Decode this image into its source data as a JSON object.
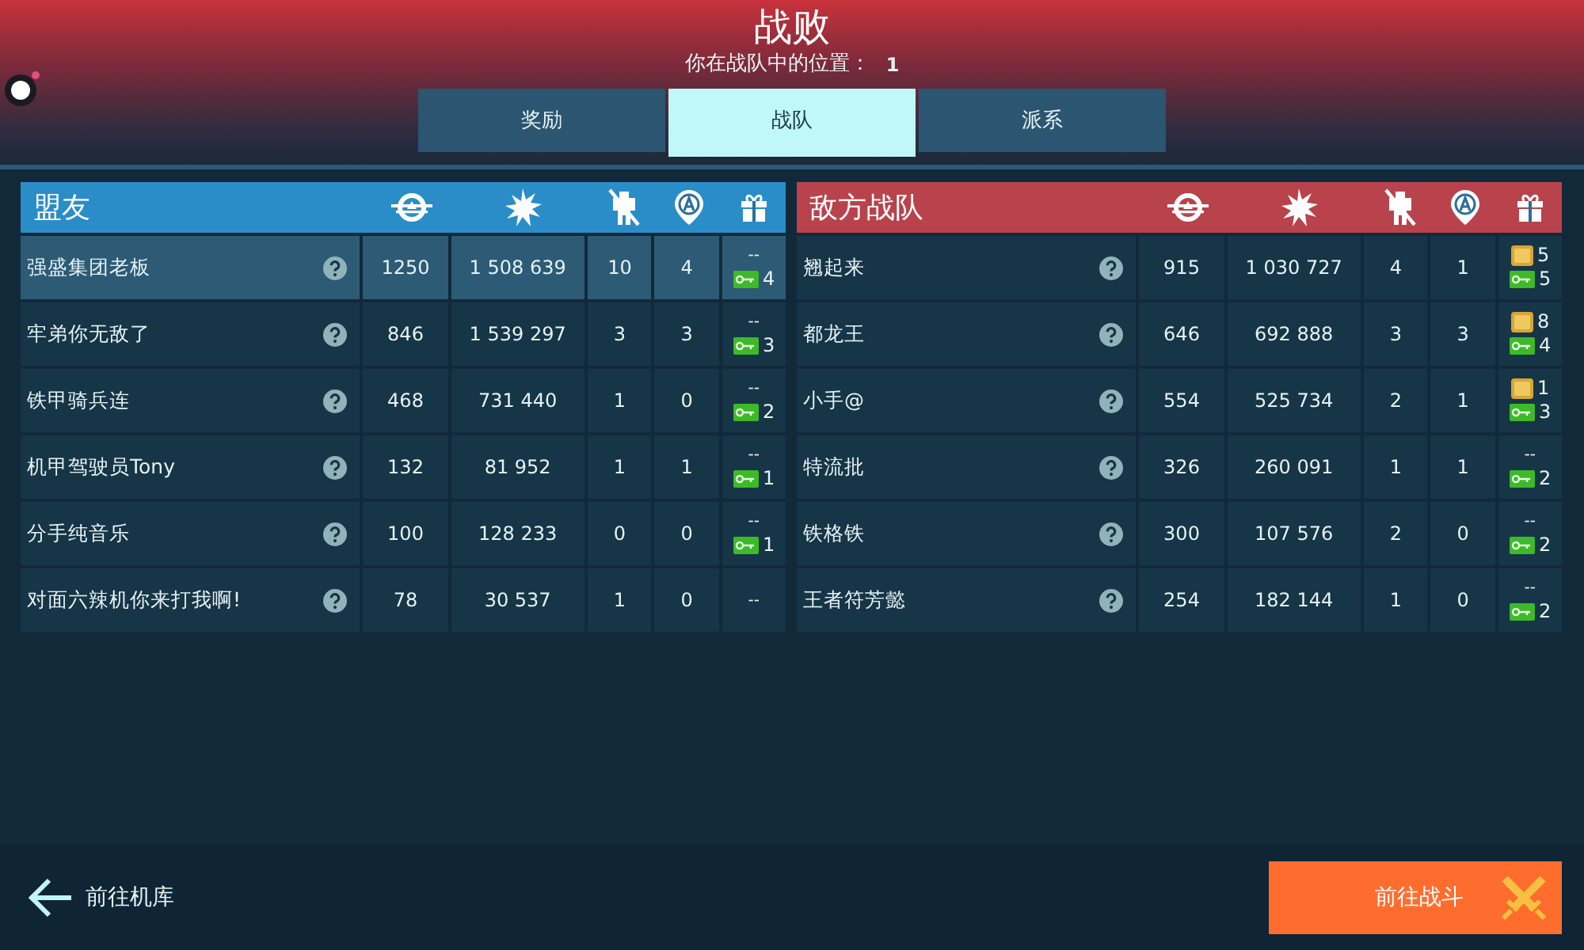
{
  "title": "战败",
  "subtitle": {
    "label": "你在战队中的位置：",
    "value": "1"
  },
  "tabs": [
    {
      "label": "奖励",
      "selected": false
    },
    {
      "label": "战队",
      "selected": true
    },
    {
      "label": "派系",
      "selected": false
    }
  ],
  "teams": [
    {
      "kind": "ally",
      "title": "盟友",
      "rows": [
        {
          "name": "强盛集团老板",
          "score": "1250",
          "damage": "1 508 639",
          "kills": "10",
          "captures": "4",
          "selected": true,
          "rewards": [
            {
              "kind": "none",
              "text": "--"
            },
            {
              "kind": "key",
              "text": "4"
            }
          ]
        },
        {
          "name": "牢弟你无敌了",
          "score": "846",
          "damage": "1 539 297",
          "kills": "3",
          "captures": "3",
          "selected": false,
          "rewards": [
            {
              "kind": "none",
              "text": "--"
            },
            {
              "kind": "key",
              "text": "3"
            }
          ]
        },
        {
          "name": "铁甲骑兵连",
          "score": "468",
          "damage": "731 440",
          "kills": "1",
          "captures": "0",
          "selected": false,
          "rewards": [
            {
              "kind": "none",
              "text": "--"
            },
            {
              "kind": "key",
              "text": "2"
            }
          ]
        },
        {
          "name": "机甲驾驶员Tony",
          "score": "132",
          "damage": "81 952",
          "kills": "1",
          "captures": "1",
          "selected": false,
          "rewards": [
            {
              "kind": "none",
              "text": "--"
            },
            {
              "kind": "key",
              "text": "1"
            }
          ]
        },
        {
          "name": "分手纯音乐",
          "score": "100",
          "damage": "128 233",
          "kills": "0",
          "captures": "0",
          "selected": false,
          "rewards": [
            {
              "kind": "none",
              "text": "--"
            },
            {
              "kind": "key",
              "text": "1"
            }
          ]
        },
        {
          "name": "对面六辣机你来打我啊!",
          "score": "78",
          "damage": "30 537",
          "kills": "1",
          "captures": "0",
          "selected": false,
          "rewards": [
            {
              "kind": "none",
              "text": "--"
            }
          ]
        }
      ]
    },
    {
      "kind": "enemy",
      "title": "敌方战队",
      "rows": [
        {
          "name": "翘起来",
          "score": "915",
          "damage": "1 030 727",
          "kills": "4",
          "captures": "1",
          "selected": false,
          "rewards": [
            {
              "kind": "coin",
              "text": "5"
            },
            {
              "kind": "key",
              "text": "5"
            }
          ]
        },
        {
          "name": "都龙王",
          "score": "646",
          "damage": "692 888",
          "kills": "3",
          "captures": "3",
          "selected": false,
          "rewards": [
            {
              "kind": "coin",
              "text": "8"
            },
            {
              "kind": "key",
              "text": "4"
            }
          ]
        },
        {
          "name": "小手@",
          "score": "554",
          "damage": "525 734",
          "kills": "2",
          "captures": "1",
          "selected": false,
          "rewards": [
            {
              "kind": "coin",
              "text": "1"
            },
            {
              "kind": "key",
              "text": "3"
            }
          ]
        },
        {
          "name": "特流批",
          "score": "326",
          "damage": "260 091",
          "kills": "1",
          "captures": "1",
          "selected": false,
          "rewards": [
            {
              "kind": "none",
              "text": "--"
            },
            {
              "kind": "key",
              "text": "2"
            }
          ]
        },
        {
          "name": "铁格铁",
          "score": "300",
          "damage": "107 576",
          "kills": "2",
          "captures": "0",
          "selected": false,
          "rewards": [
            {
              "kind": "none",
              "text": "--"
            },
            {
              "kind": "key",
              "text": "2"
            }
          ]
        },
        {
          "name": "王者符芳懿",
          "score": "254",
          "damage": "182 144",
          "kills": "1",
          "captures": "0",
          "selected": false,
          "rewards": [
            {
              "kind": "none",
              "text": "--"
            },
            {
              "kind": "key",
              "text": "2"
            }
          ]
        }
      ]
    }
  ],
  "back_button": "前往机库",
  "battle_button": "前往战斗"
}
